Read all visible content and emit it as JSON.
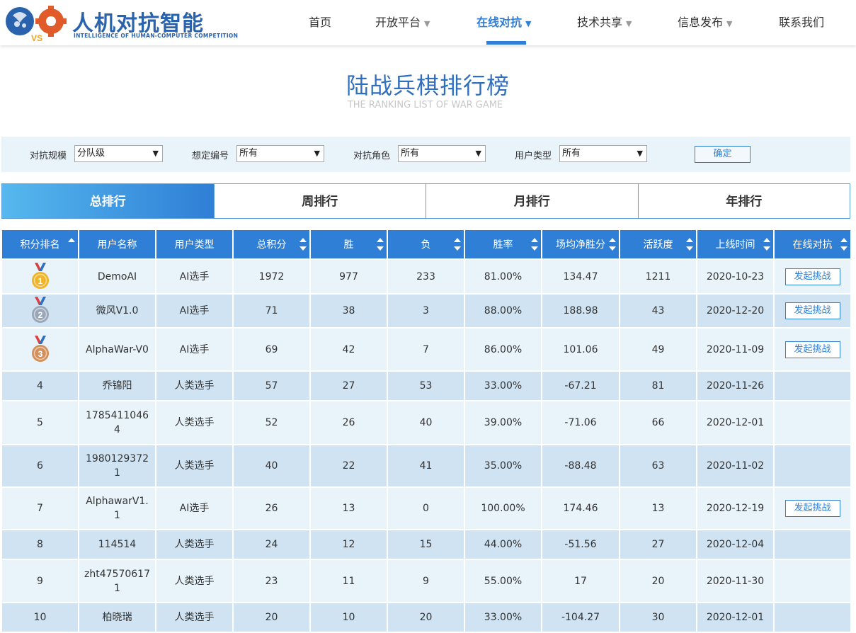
{
  "brand": {
    "title": "人机对抗智能",
    "subtitle": "INTELLIGENCE OF HUMAN-COMPUTER COMPETITION",
    "icon_badge": "VS"
  },
  "nav": {
    "items": [
      {
        "label": "首页",
        "has_dropdown": false
      },
      {
        "label": "开放平台",
        "has_dropdown": true
      },
      {
        "label": "在线对抗",
        "has_dropdown": true,
        "active": true
      },
      {
        "label": "技术共享",
        "has_dropdown": true
      },
      {
        "label": "信息发布",
        "has_dropdown": true
      },
      {
        "label": "联系我们",
        "has_dropdown": false
      }
    ],
    "caret": "▼"
  },
  "page": {
    "title": "陆战兵棋排行榜",
    "subtitle": "THE RANKING LIST OF WAR GAME"
  },
  "filters": {
    "scale_label": "对抗规模",
    "scale_value": "分队级",
    "scenario_label": "想定编号",
    "scenario_value": "所有",
    "role_label": "对抗角色",
    "role_value": "所有",
    "usertype_label": "用户类型",
    "usertype_value": "所有",
    "confirm_label": "确定"
  },
  "tabs": [
    {
      "label": "总排行",
      "active": true
    },
    {
      "label": "周排行",
      "active": false
    },
    {
      "label": "月排行",
      "active": false
    },
    {
      "label": "年排行",
      "active": false
    }
  ],
  "table": {
    "headers": [
      "积分排名",
      "用户名称",
      "用户类型",
      "总积分",
      "胜",
      "负",
      "胜率",
      "场均净胜分",
      "活跃度",
      "上线时间",
      "在线对抗"
    ],
    "challenge_label": "发起挑战",
    "rows": [
      {
        "rank": "1",
        "medal": "gold-medal",
        "name": "DemoAI",
        "type": "AI选手",
        "score": "1972",
        "win": "977",
        "loss": "233",
        "rate": "81.00%",
        "avg": "134.47",
        "active": "1211",
        "date": "2020-10-23",
        "challenge": true
      },
      {
        "rank": "2",
        "medal": "silver-medal",
        "name": "微风V1.0",
        "type": "AI选手",
        "score": "71",
        "win": "38",
        "loss": "3",
        "rate": "88.00%",
        "avg": "188.98",
        "active": "43",
        "date": "2020-12-20",
        "challenge": true
      },
      {
        "rank": "3",
        "medal": "bronze-medal",
        "name": "AlphaWar-V0",
        "type": "AI选手",
        "score": "69",
        "win": "42",
        "loss": "7",
        "rate": "86.00%",
        "avg": "101.06",
        "active": "49",
        "date": "2020-11-09",
        "challenge": true
      },
      {
        "rank": "4",
        "medal": "",
        "name": "乔锦阳",
        "type": "人类选手",
        "score": "57",
        "win": "27",
        "loss": "53",
        "rate": "33.00%",
        "avg": "-67.21",
        "active": "81",
        "date": "2020-11-26",
        "challenge": false
      },
      {
        "rank": "5",
        "medal": "",
        "name": "17854110464",
        "type": "人类选手",
        "score": "52",
        "win": "26",
        "loss": "40",
        "rate": "39.00%",
        "avg": "-71.06",
        "active": "66",
        "date": "2020-12-01",
        "challenge": false
      },
      {
        "rank": "6",
        "medal": "",
        "name": "19801293721",
        "type": "人类选手",
        "score": "40",
        "win": "22",
        "loss": "41",
        "rate": "35.00%",
        "avg": "-88.48",
        "active": "63",
        "date": "2020-11-02",
        "challenge": false
      },
      {
        "rank": "7",
        "medal": "",
        "name": "AlphawarV1.1",
        "type": "AI选手",
        "score": "26",
        "win": "13",
        "loss": "0",
        "rate": "100.00%",
        "avg": "174.46",
        "active": "13",
        "date": "2020-12-19",
        "challenge": true
      },
      {
        "rank": "8",
        "medal": "",
        "name": "114514",
        "type": "人类选手",
        "score": "24",
        "win": "12",
        "loss": "15",
        "rate": "44.00%",
        "avg": "-51.56",
        "active": "27",
        "date": "2020-12-04",
        "challenge": false
      },
      {
        "rank": "9",
        "medal": "",
        "name": "zht475706171",
        "type": "人类选手",
        "score": "23",
        "win": "11",
        "loss": "9",
        "rate": "55.00%",
        "avg": "17",
        "active": "20",
        "date": "2020-11-30",
        "challenge": false
      },
      {
        "rank": "10",
        "medal": "",
        "name": "柏晓瑞",
        "type": "人类选手",
        "score": "20",
        "win": "10",
        "loss": "20",
        "rate": "33.00%",
        "avg": "-104.27",
        "active": "30",
        "date": "2020-12-01",
        "challenge": false
      }
    ]
  },
  "colors": {
    "accent": "#2f7fd6",
    "title_blue": "#2f6fbf",
    "row_light": "#e9f3fa",
    "row_dark": "#cfe3f2",
    "gold": "#f0b429",
    "silver": "#9aa7b8",
    "bronze": "#d4905a"
  }
}
